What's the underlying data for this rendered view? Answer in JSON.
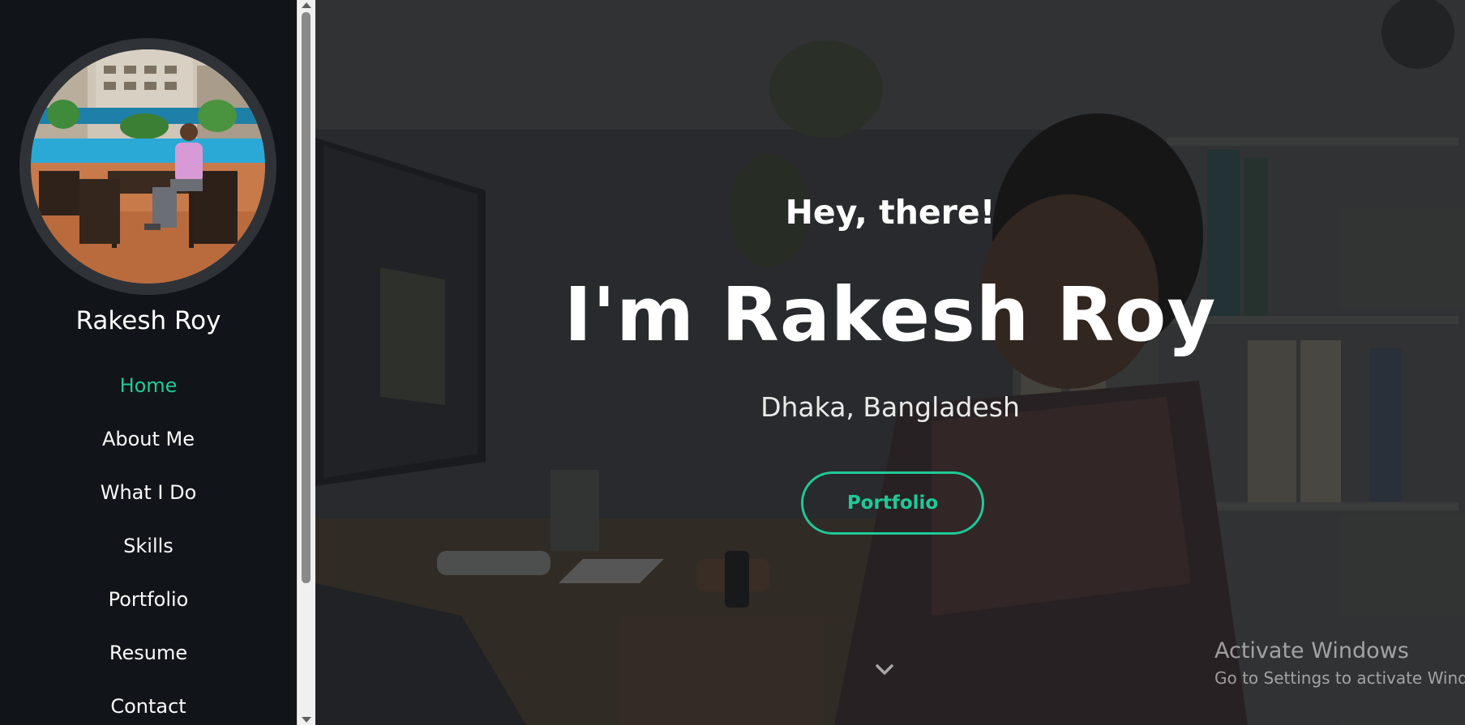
{
  "profile": {
    "name": "Rakesh Roy",
    "avatar_icon": "profile-photo"
  },
  "nav": {
    "items": [
      {
        "label": "Home",
        "active": true
      },
      {
        "label": "About Me"
      },
      {
        "label": "What I Do"
      },
      {
        "label": "Skills"
      },
      {
        "label": "Portfolio"
      },
      {
        "label": "Resume"
      },
      {
        "label": "Contact"
      }
    ]
  },
  "hero": {
    "greeting": "Hey, there!",
    "headline": "I'm Rakesh Roy",
    "location": "Dhaka, Bangladesh",
    "cta_label": "Portfolio",
    "scroll_icon": "chevron-down-icon"
  },
  "watermark": {
    "title": "Activate Windows",
    "subtitle": "Go to Settings to activate Windows."
  },
  "colors": {
    "accent": "#20c997",
    "sidebar_bg": "#111418"
  }
}
